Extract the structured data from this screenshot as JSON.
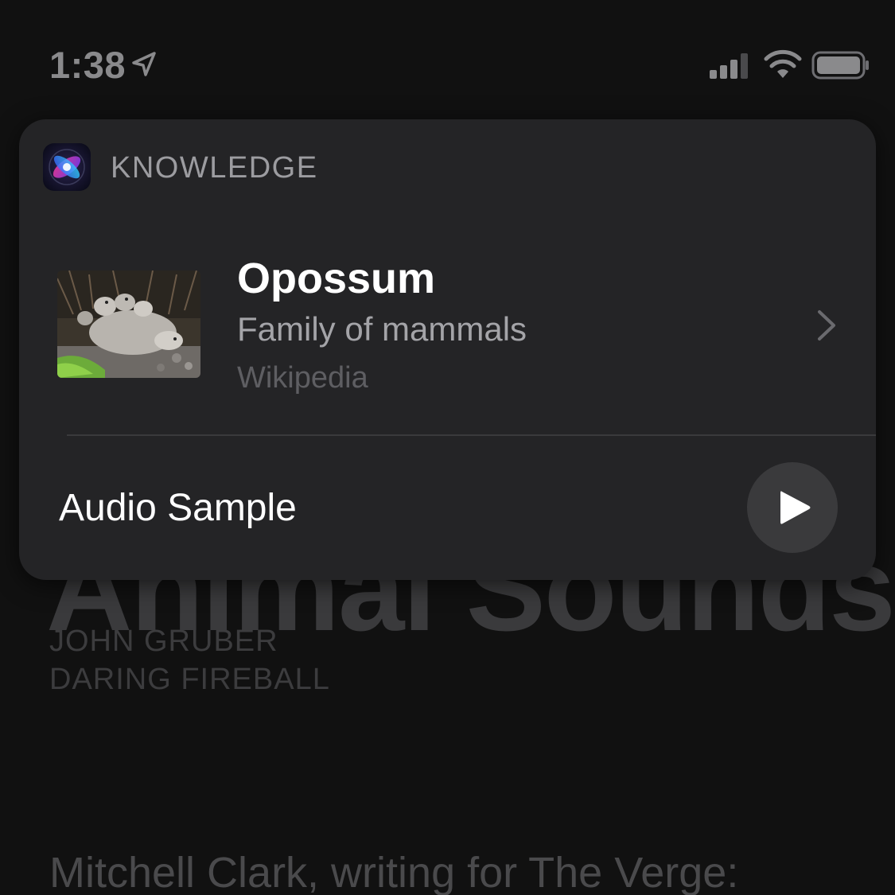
{
  "status_bar": {
    "time": "1:38",
    "icons": [
      "location-arrow-icon",
      "cellular-signal-icon",
      "wifi-icon",
      "battery-icon"
    ]
  },
  "background_article": {
    "title": "Animal Sounds",
    "author": "JOHN GRUBER",
    "publication": "DARING FIREBALL",
    "body_first_line": "Mitchell Clark, writing for The Verge:"
  },
  "siri_card": {
    "header_icon": "siri-icon",
    "header_label": "KNOWLEDGE",
    "result": {
      "title": "Opossum",
      "subtitle": "Family of mammals",
      "source": "Wikipedia",
      "thumbnail": "opossum-photo"
    },
    "audio": {
      "label": "Audio Sample",
      "action_icon": "play-icon"
    }
  },
  "colors": {
    "background": "#111111",
    "card": "#242426",
    "title_text": "#ffffff",
    "secondary_text": "#a4a4a8",
    "tertiary_text": "#5e5e62",
    "play_button": "#3a3a3c"
  }
}
